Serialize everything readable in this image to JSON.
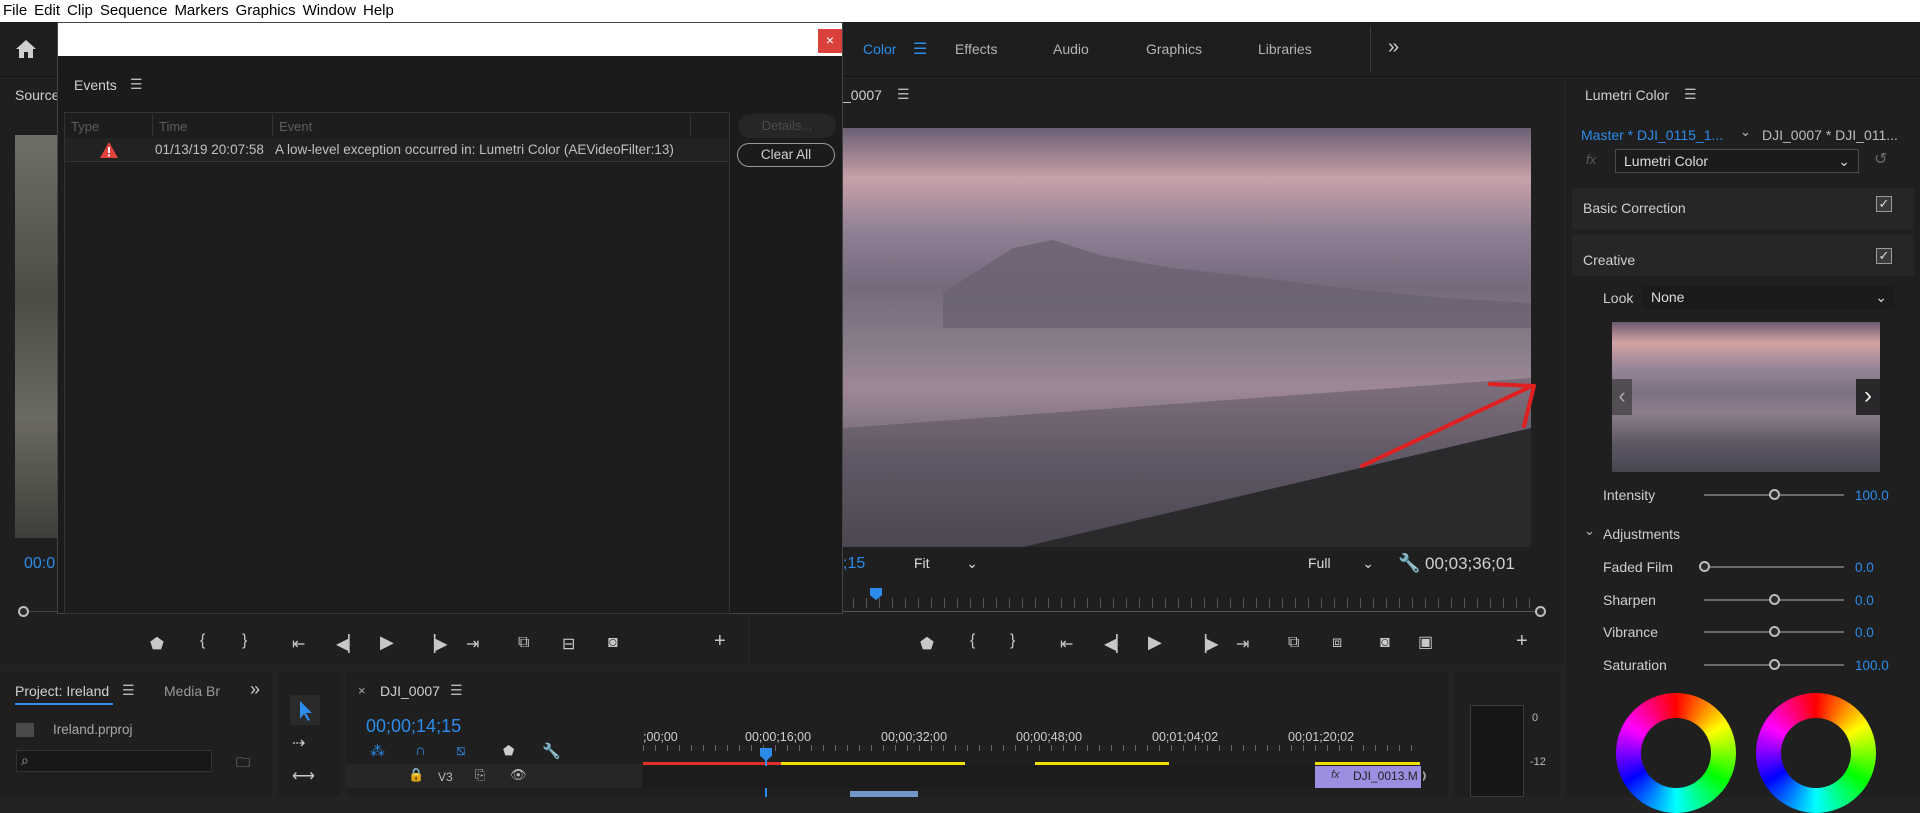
{
  "menu": [
    "File",
    "Edit",
    "Clip",
    "Sequence",
    "Markers",
    "Graphics",
    "Window",
    "Help"
  ],
  "workspaces": {
    "color": "Color",
    "effects": "Effects",
    "audio": "Audio",
    "graphics": "Graphics",
    "libraries": "Libraries",
    "more": "»"
  },
  "source_tab": "Source",
  "source_timecode": "00:0",
  "program": {
    "tab": "_0007",
    "timecode_left": ";15",
    "fit": "Fit",
    "quality": "Full",
    "timecode_right": "00;03;36;01"
  },
  "events": {
    "tab": "Events",
    "columns": {
      "type": "Type",
      "time": "Time",
      "event": "Event"
    },
    "rows": [
      {
        "time": "01/13/19 20:07:58",
        "event": "A low-level exception occurred in: Lumetri Color (AEVideoFilter:13)"
      }
    ],
    "details_label": "Details...",
    "clear_label": "Clear All",
    "close": "×"
  },
  "lumetri": {
    "title": "Lumetri Color",
    "master_clip": "Master * DJI_0115_1...",
    "seq_clip": "DJI_0007 * DJI_011...",
    "fx": "fx",
    "effect_name": "Lumetri Color",
    "basic_correction": "Basic Correction",
    "creative": "Creative",
    "look_label": "Look",
    "look_value": "None",
    "intensity_label": "Intensity",
    "intensity_value": "100.0",
    "intensity_pct": 0.5,
    "adjustments": "Adjustments",
    "params": [
      {
        "label": "Faded Film",
        "value": "0.0",
        "pct": 0
      },
      {
        "label": "Sharpen",
        "value": "0.0",
        "pct": 0.5
      },
      {
        "label": "Vibrance",
        "value": "0.0",
        "pct": 0.5
      },
      {
        "label": "Saturation",
        "value": "100.0",
        "pct": 0.5
      }
    ]
  },
  "project": {
    "tab": "Project: Ireland",
    "media_tab": "Media Br",
    "file": "Ireland.prproj",
    "more": "»"
  },
  "timeline": {
    "tab": "DJI_0007",
    "close": "×",
    "timecode": "00;00;14;15",
    "ruler": [
      ";00;00",
      "00;00;16;00",
      "00;00;32;00",
      "00;00;48;00",
      "00;01;04;02",
      "00;01;20;02"
    ],
    "track": "V3",
    "clip": "DJI_0013.M",
    "clip_fx": "fx"
  },
  "meter": {
    "labels": [
      "0",
      "-12"
    ]
  },
  "colors": {
    "accent": "#2d8ceb",
    "panel": "#1f1f1f",
    "annotation": "#e02020",
    "clip": "#9c8ee0"
  }
}
